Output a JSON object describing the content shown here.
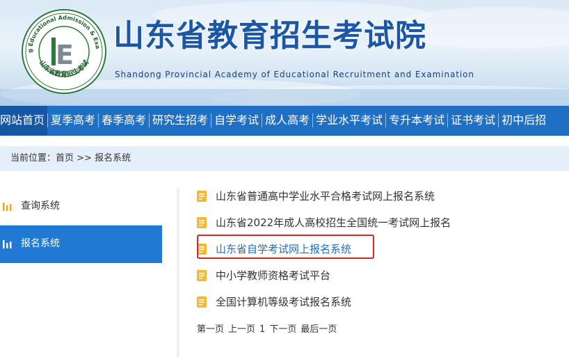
{
  "header": {
    "title": "山东省教育招生考试院",
    "subtitle": "Shandong Provincial Academy of Educational Recruitment and Examination",
    "logo_ring_text": "Shandong Educational Admission & Examinations",
    "logo_bottom_text": "山东省教育招生考试",
    "logo_letter": "E"
  },
  "nav": {
    "items": [
      {
        "label": "网站首页"
      },
      {
        "label": "夏季高考"
      },
      {
        "label": "春季高考"
      },
      {
        "label": "研究生招考"
      },
      {
        "label": "自学考试"
      },
      {
        "label": "成人高考"
      },
      {
        "label": "学业水平考试"
      },
      {
        "label": "专升本考试"
      },
      {
        "label": "证书考试"
      },
      {
        "label": "初中后招"
      }
    ]
  },
  "breadcrumb": {
    "prefix": "当前位置：",
    "home": "首页",
    "sep": " >> ",
    "current": "报名系统"
  },
  "sidebar": {
    "items": [
      {
        "label": "查询系统",
        "icon": "bar-chart-icon"
      },
      {
        "label": "报名系统",
        "icon": "bar-chart-icon"
      }
    ]
  },
  "list": {
    "items": [
      {
        "label": "山东省普通高中学业水平合格考试网上报名系统"
      },
      {
        "label": "山东省2022年成人高校招生全国统一考试网上报名"
      },
      {
        "label": "山东省自学考试网上报名系统"
      },
      {
        "label": "中小学教师资格考试平台"
      },
      {
        "label": "全国计算机等级考试报名系统"
      }
    ]
  },
  "pager": {
    "first": "第一页",
    "prev": "上一页",
    "current": "1",
    "next": "下一页",
    "last": "最后一页"
  },
  "colors": {
    "nav_bg": "#1f6fc5",
    "title_blue": "#1c56a6",
    "sidebar_active": "#2079d3",
    "highlight_red": "#e02424",
    "doc_icon_yellow": "#f5b82e"
  }
}
